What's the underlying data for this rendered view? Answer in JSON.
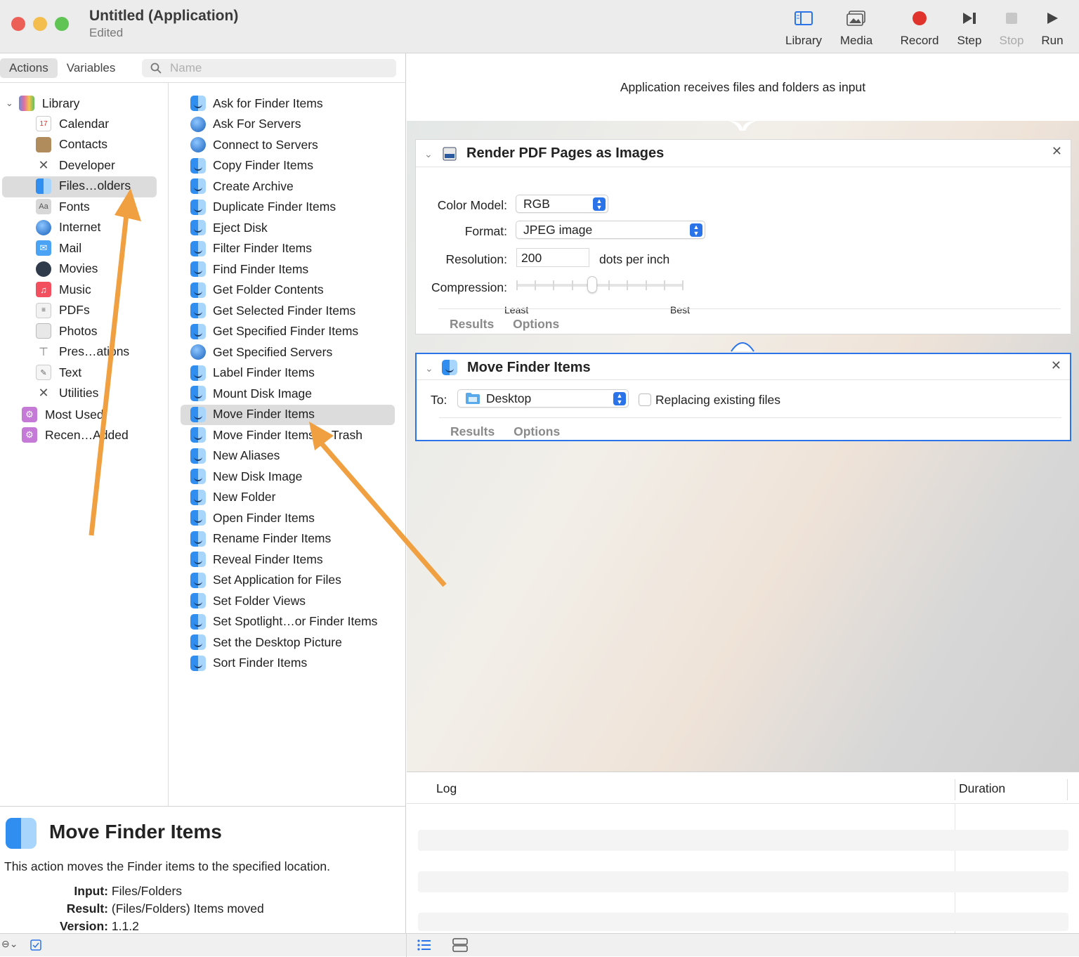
{
  "window": {
    "title": "Untitled (Application)",
    "subtitle": "Edited"
  },
  "toolbar": {
    "library": "Library",
    "media": "Media",
    "record": "Record",
    "step": "Step",
    "stop": "Stop",
    "run": "Run"
  },
  "tabs": {
    "actions": "Actions",
    "variables": "Variables"
  },
  "search": {
    "placeholder": "Name"
  },
  "library": {
    "root": "Library",
    "items": [
      {
        "label": "Calendar",
        "icon": "calendar-icon"
      },
      {
        "label": "Contacts",
        "icon": "contacts-icon"
      },
      {
        "label": "Developer",
        "icon": "developer-icon"
      },
      {
        "label": "Files…olders",
        "icon": "finder-icon"
      },
      {
        "label": "Fonts",
        "icon": "fonts-icon"
      },
      {
        "label": "Internet",
        "icon": "globe-icon"
      },
      {
        "label": "Mail",
        "icon": "mail-icon"
      },
      {
        "label": "Movies",
        "icon": "movies-icon"
      },
      {
        "label": "Music",
        "icon": "music-icon"
      },
      {
        "label": "PDFs",
        "icon": "pdf-icon"
      },
      {
        "label": "Photos",
        "icon": "photos-icon"
      },
      {
        "label": "Pres…ations",
        "icon": "presentations-icon"
      },
      {
        "label": "Text",
        "icon": "text-icon"
      },
      {
        "label": "Utilities",
        "icon": "utilities-icon"
      }
    ],
    "most_used": "Most Used",
    "recently_added": "Recen…Added",
    "selected": "Files…olders"
  },
  "actions": [
    "Ask for Finder Items",
    "Ask For Servers",
    "Connect to Servers",
    "Copy Finder Items",
    "Create Archive",
    "Duplicate Finder Items",
    "Eject Disk",
    "Filter Finder Items",
    "Find Finder Items",
    "Get Folder Contents",
    "Get Selected Finder Items",
    "Get Specified Finder Items",
    "Get Specified Servers",
    "Label Finder Items",
    "Mount Disk Image",
    "Move Finder Items",
    "Move Finder Items to Trash",
    "New Aliases",
    "New Disk Image",
    "New Folder",
    "Open Finder Items",
    "Rename Finder Items",
    "Reveal Finder Items",
    "Set Application for Files",
    "Set Folder Views",
    "Set Spotlight…or Finder Items",
    "Set the Desktop Picture",
    "Sort Finder Items"
  ],
  "description": {
    "title": "Move Finder Items",
    "text": "This action moves the Finder items to the specified location.",
    "input_label": "Input:",
    "input_value": "Files/Folders",
    "result_label": "Result:",
    "result_value": "(Files/Folders) Items moved",
    "version_label": "Version:",
    "version_value": "1.1.2"
  },
  "workflow": {
    "input_text": "Application receives files and folders as input",
    "render_card": {
      "title": "Render PDF Pages as Images",
      "color_model_label": "Color Model:",
      "color_model_value": "RGB",
      "format_label": "Format:",
      "format_value": "JPEG image",
      "resolution_label": "Resolution:",
      "resolution_value": "200",
      "resolution_unit": "dots per inch",
      "compression_label": "Compression:",
      "compression_level": 0.45,
      "least": "Least",
      "best": "Best",
      "results": "Results",
      "options": "Options"
    },
    "move_card": {
      "title": "Move Finder Items",
      "to_label": "To:",
      "to_value": "Desktop",
      "replacing_label": "Replacing existing files",
      "replacing_checked": false,
      "results": "Results",
      "options": "Options"
    }
  },
  "log": {
    "log_header": "Log",
    "duration_header": "Duration"
  },
  "colors": {
    "accent": "#2a73e8",
    "arrow": "#f0a040",
    "record": "#e0332c"
  }
}
